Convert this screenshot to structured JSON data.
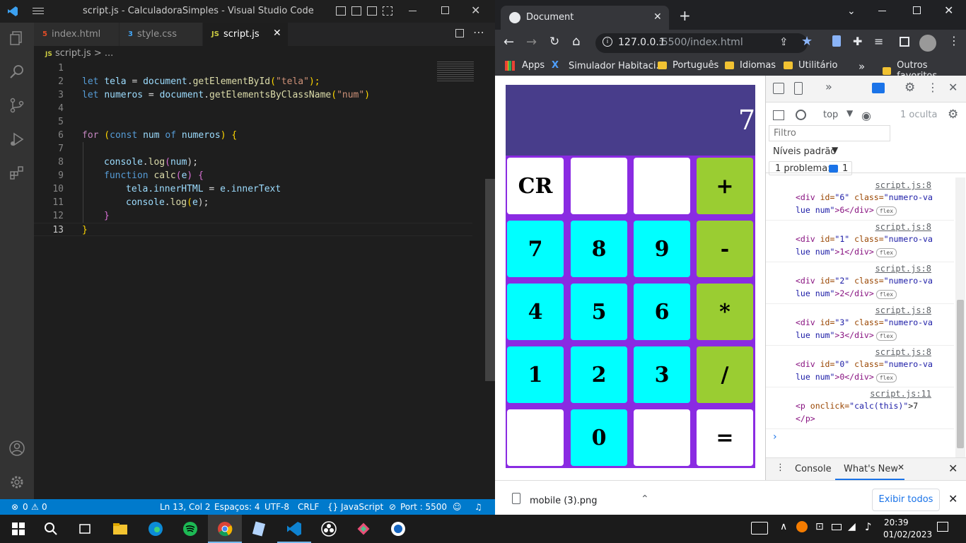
{
  "vscode": {
    "title": "script.js - CalculadoraSimples - Visual Studio Code",
    "tabs": [
      {
        "label": "index.html",
        "icon": "html5-icon",
        "color": "#e34c26"
      },
      {
        "label": "style.css",
        "icon": "css3-icon",
        "color": "#42a5f5"
      },
      {
        "label": "script.js",
        "icon": "js-icon",
        "color": "#cbcb41"
      }
    ],
    "breadcrumb": {
      "file": "script.js",
      "rest": "> ..."
    },
    "line_numbers": [
      "1",
      "2",
      "3",
      "4",
      "5",
      "6",
      "7",
      "8",
      "9",
      "10",
      "11",
      "12",
      "13"
    ],
    "code": {
      "l2": {
        "kw": "let",
        "name": "tela",
        "eq": " = ",
        "obj": "document",
        "dot": ".",
        "fn": "getElementById",
        "open": "(",
        "str": "\"tela\"",
        "close": ");"
      },
      "l3": {
        "kw": "let",
        "name": "numeros",
        "eq": " = ",
        "obj": "document",
        "dot": ".",
        "fn": "getElementsByClassName",
        "open": "(",
        "str": "\"num\"",
        "close": ")"
      },
      "l6": {
        "kw": "for",
        "open": " (",
        "const": "const",
        "num": "num",
        "of": " of ",
        "arr": "numeros",
        "close": ") {"
      },
      "l8": {
        "obj": "console",
        "dot": ".",
        "fn": "log",
        "arg": "num",
        "end": ");"
      },
      "l9": {
        "kw": "function",
        "fn": "calc",
        "arg": "e",
        "end": " {"
      },
      "l10": {
        "a": "tela",
        "b": ".innerHTML",
        "eq": " = ",
        "c": "e",
        "d": ".innerText"
      },
      "l11": {
        "obj": "console",
        "dot": ".",
        "fn": "log",
        "arg": "e",
        "end": ");"
      },
      "l12": "}",
      "l13": "}"
    },
    "status": {
      "errors": "0",
      "warnings": "0",
      "position": "Ln 13, Col 2",
      "spaces": "Espaços: 4",
      "encoding": "UTF-8",
      "eol": "CRLF",
      "language": "JavaScript",
      "port": "Port : 5500"
    }
  },
  "chrome": {
    "tab_title": "Document",
    "url_host": "127.0.0.1",
    "url_rest": ":5500/index.html",
    "bookmarks": [
      "Apps",
      "Simulador Habitaci...",
      "Português",
      "Idiomas",
      "Utilitário"
    ],
    "other_bookmarks": "Outros favoritos",
    "download_file": "mobile (3).png",
    "download_show_all": "Exibir todos"
  },
  "calculator": {
    "display": "7",
    "rows": [
      [
        {
          "label": "CR",
          "color": "white"
        },
        {
          "label": "",
          "color": "white"
        },
        {
          "label": "",
          "color": "white"
        },
        {
          "label": "+",
          "color": "green"
        }
      ],
      [
        {
          "label": "7",
          "color": "cyan"
        },
        {
          "label": "8",
          "color": "cyan"
        },
        {
          "label": "9",
          "color": "cyan"
        },
        {
          "label": "-",
          "color": "green"
        }
      ],
      [
        {
          "label": "4",
          "color": "cyan"
        },
        {
          "label": "5",
          "color": "cyan"
        },
        {
          "label": "6",
          "color": "cyan"
        },
        {
          "label": "*",
          "color": "green"
        }
      ],
      [
        {
          "label": "1",
          "color": "cyan"
        },
        {
          "label": "2",
          "color": "cyan"
        },
        {
          "label": "3",
          "color": "cyan"
        },
        {
          "label": "/",
          "color": "green"
        }
      ],
      [
        {
          "label": "",
          "color": "white"
        },
        {
          "label": "0",
          "color": "cyan"
        },
        {
          "label": "",
          "color": "white"
        },
        {
          "label": "=",
          "color": "white"
        }
      ]
    ]
  },
  "devtools": {
    "context": "top",
    "hidden": "1 oculta",
    "filter_placeholder": "Filtro",
    "levels": "Níveis padrão",
    "issues": "1 problema:",
    "issues_count": "1",
    "logs": [
      {
        "src": "script.js:8",
        "l1": {
          "tag": "<div ",
          "a1": "id=",
          "v1": "\"6\"",
          "a2": " class=",
          "v2": "\"numero-va"
        },
        "l2": {
          "v": "lue num\"",
          "t": ">6</div>"
        }
      },
      {
        "src": "script.js:8",
        "l1": {
          "tag": "<div ",
          "a1": "id=",
          "v1": "\"1\"",
          "a2": " class=",
          "v2": "\"numero-va"
        },
        "l2": {
          "v": "lue num\"",
          "t": ">1</div>"
        }
      },
      {
        "src": "script.js:8",
        "l1": {
          "tag": "<div ",
          "a1": "id=",
          "v1": "\"2\"",
          "a2": " class=",
          "v2": "\"numero-va"
        },
        "l2": {
          "v": "lue num\"",
          "t": ">2</div>"
        }
      },
      {
        "src": "script.js:8",
        "l1": {
          "tag": "<div ",
          "a1": "id=",
          "v1": "\"3\"",
          "a2": " class=",
          "v2": "\"numero-va"
        },
        "l2": {
          "v": "lue num\"",
          "t": ">3</div>"
        }
      },
      {
        "src": "script.js:8",
        "l1": {
          "tag": "<div ",
          "a1": "id=",
          "v1": "\"0\"",
          "a2": " class=",
          "v2": "\"numero-va"
        },
        "l2": {
          "v": "lue num\"",
          "t": ">0</div>"
        }
      }
    ],
    "badge": "flex",
    "last_log": {
      "src": "script.js:11",
      "tag": "<p ",
      "attr": "onclick=",
      "val": "\"calc(this)\"",
      "text": ">7",
      "close": "</p>"
    },
    "drawer_console": "Console",
    "drawer_whats_new": "What's New"
  },
  "taskbar": {
    "time": "20:39",
    "date": "01/02/2023"
  }
}
